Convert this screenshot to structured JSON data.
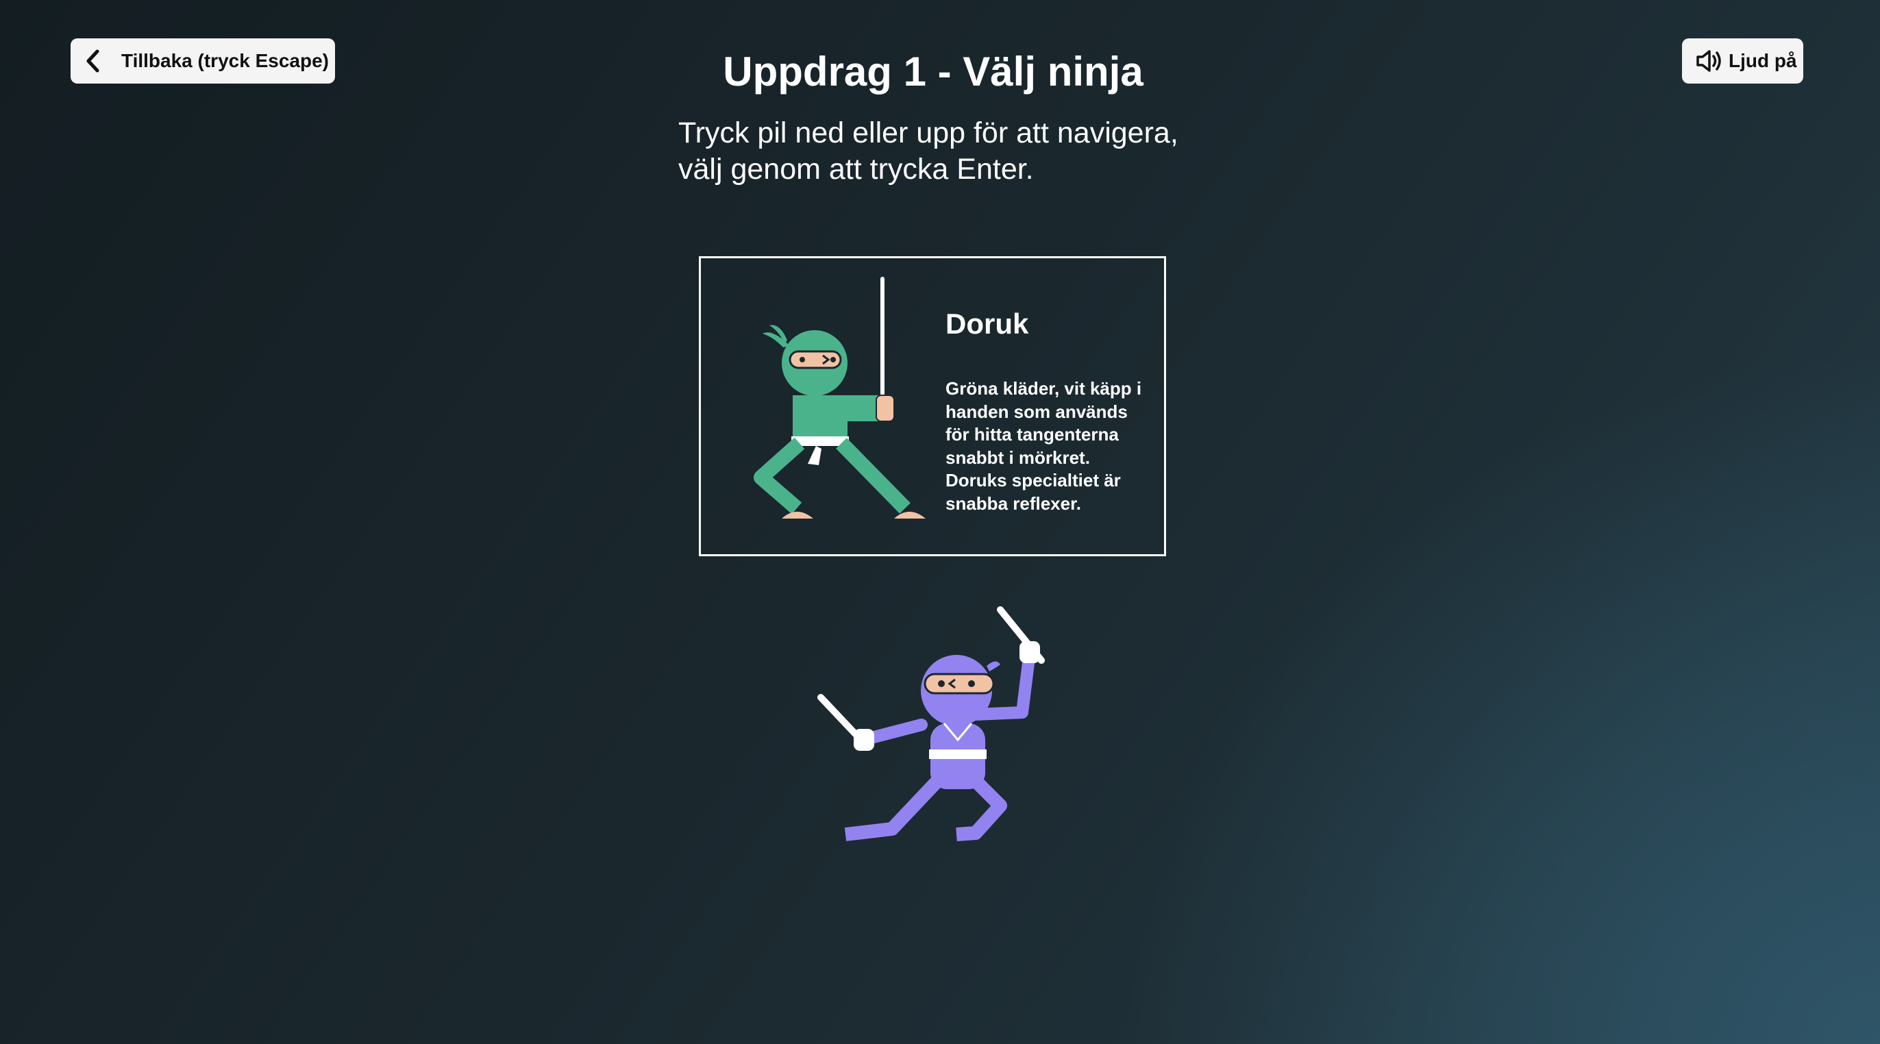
{
  "header": {
    "back_label": "Tillbaka (tryck Escape)",
    "back_icon": "chevron-left-icon",
    "sound_label": "Ljud på",
    "sound_icon": "speaker-on-icon",
    "title": "Uppdrag 1 - Välj ninja",
    "instructions_line1": "Tryck pil ned eller upp för att navigera,",
    "instructions_line2": "välj genom att trycka Enter."
  },
  "selected_ninja": {
    "name": "Doruk",
    "description": "Gröna kläder, vit käpp i handen som används för hitta tangenterna snabbt i mörkret. Doruks specialtiet är snabba reflexer.",
    "color": "#4bb38c",
    "skin": "#f2c2a5"
  },
  "other_ninja": {
    "color": "#9383f0"
  }
}
